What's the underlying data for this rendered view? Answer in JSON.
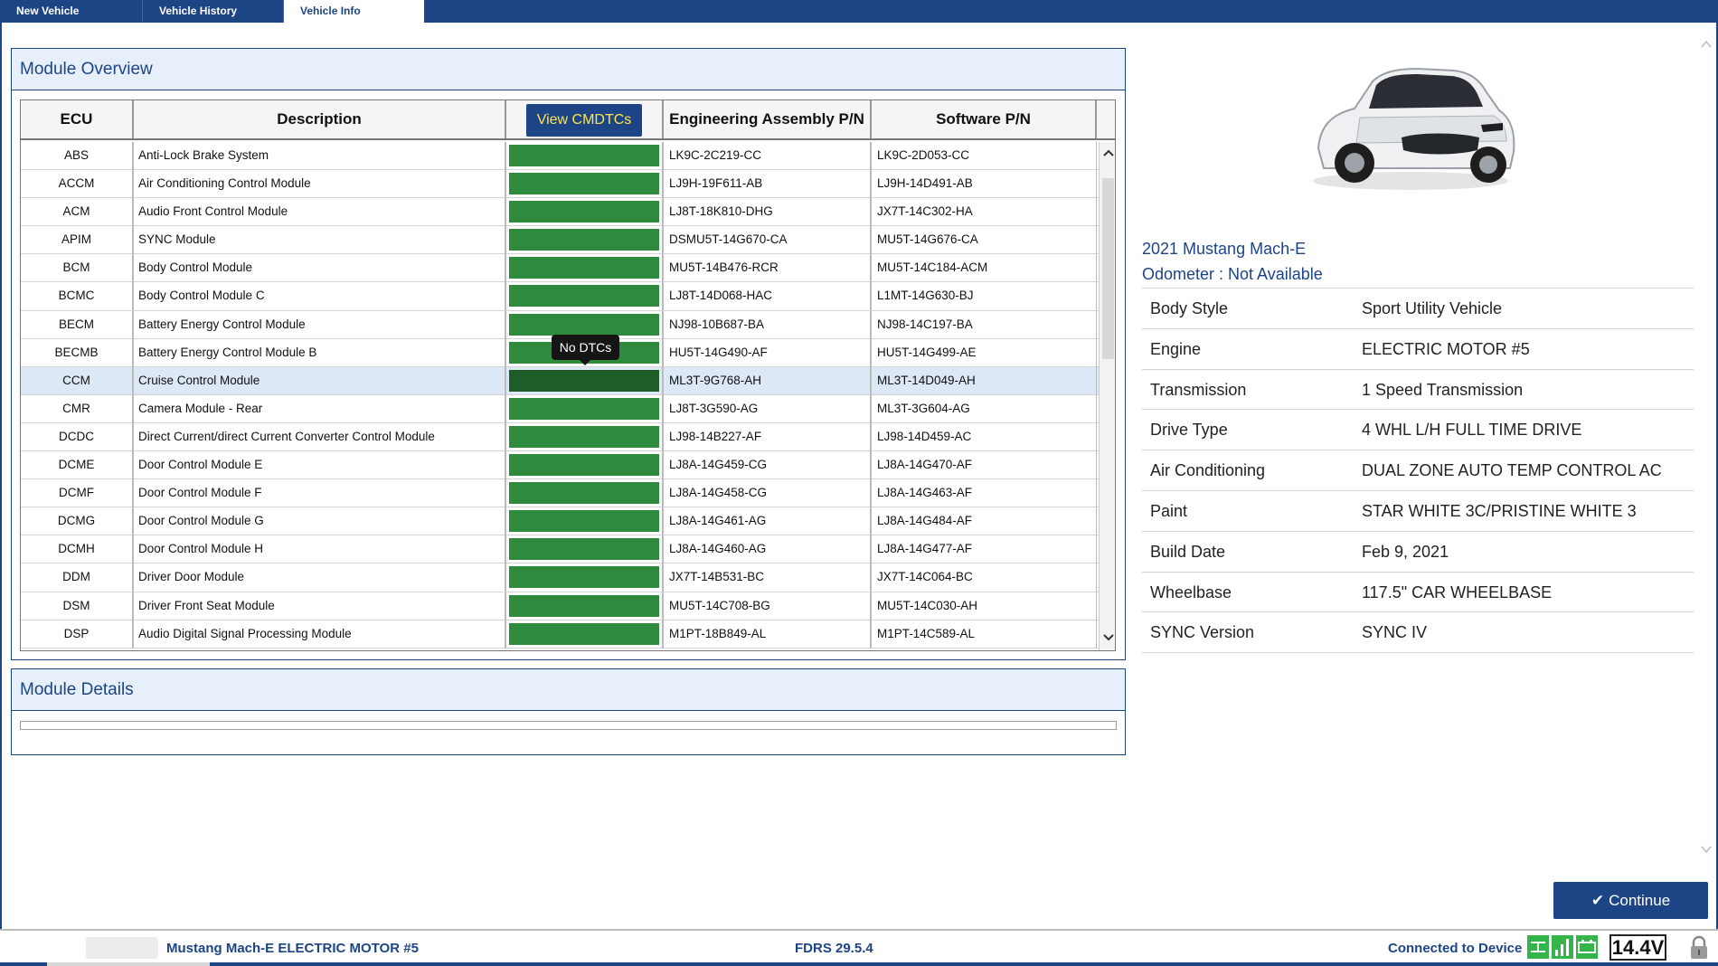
{
  "tabs": [
    {
      "label": "New Vehicle"
    },
    {
      "label": "Vehicle History"
    },
    {
      "label": "Vehicle Info"
    }
  ],
  "overview": {
    "title": "Module Overview",
    "columns": {
      "ecu": "ECU",
      "description": "Description",
      "dtc_button": "View CMDTCs",
      "eng": "Engineering Assembly P/N",
      "sw": "Software P/N"
    },
    "rows": [
      {
        "ecu": "ABS",
        "desc": "Anti-Lock Brake System",
        "eng": "LK9C-2C219-CC",
        "sw": "LK9C-2D053-CC"
      },
      {
        "ecu": "ACCM",
        "desc": "Air Conditioning Control Module",
        "eng": "LJ9H-19F611-AB",
        "sw": "LJ9H-14D491-AB"
      },
      {
        "ecu": "ACM",
        "desc": "Audio Front Control Module",
        "eng": "LJ8T-18K810-DHG",
        "sw": "JX7T-14C302-HA"
      },
      {
        "ecu": "APIM",
        "desc": "SYNC Module",
        "eng": "DSMU5T-14G670-CA",
        "sw": "MU5T-14G676-CA"
      },
      {
        "ecu": "BCM",
        "desc": "Body Control Module",
        "eng": "MU5T-14B476-RCR",
        "sw": "MU5T-14C184-ACM"
      },
      {
        "ecu": "BCMC",
        "desc": "Body Control Module C",
        "eng": "LJ8T-14D068-HAC",
        "sw": "L1MT-14G630-BJ"
      },
      {
        "ecu": "BECM",
        "desc": "Battery Energy Control Module",
        "eng": "NJ98-10B687-BA",
        "sw": "NJ98-14C197-BA"
      },
      {
        "ecu": "BECMB",
        "desc": "Battery Energy Control Module B",
        "eng": "HU5T-14G490-AF",
        "sw": "HU5T-14G499-AE"
      },
      {
        "ecu": "CCM",
        "desc": "Cruise Control Module",
        "eng": "ML3T-9G768-AH",
        "sw": "ML3T-14D049-AH"
      },
      {
        "ecu": "CMR",
        "desc": "Camera Module - Rear",
        "eng": "LJ8T-3G590-AG",
        "sw": "ML3T-3G604-AG"
      },
      {
        "ecu": "DCDC",
        "desc": "Direct Current/direct Current Converter Control Module",
        "eng": "LJ98-14B227-AF",
        "sw": "LJ98-14D459-AC"
      },
      {
        "ecu": "DCME",
        "desc": "Door Control Module E",
        "eng": "LJ8A-14G459-CG",
        "sw": "LJ8A-14G470-AF"
      },
      {
        "ecu": "DCMF",
        "desc": "Door Control Module F",
        "eng": "LJ8A-14G458-CG",
        "sw": "LJ8A-14G463-AF"
      },
      {
        "ecu": "DCMG",
        "desc": "Door Control Module G",
        "eng": "LJ8A-14G461-AG",
        "sw": "LJ8A-14G484-AF"
      },
      {
        "ecu": "DCMH",
        "desc": "Door Control Module H",
        "eng": "LJ8A-14G460-AG",
        "sw": "LJ8A-14G477-AF"
      },
      {
        "ecu": "DDM",
        "desc": "Driver Door Module",
        "eng": "JX7T-14B531-BC",
        "sw": "JX7T-14C064-BC"
      },
      {
        "ecu": "DSM",
        "desc": "Driver Front Seat Module",
        "eng": "MU5T-14C708-BG",
        "sw": "MU5T-14C030-AH"
      },
      {
        "ecu": "DSP",
        "desc": "Audio Digital Signal Processing Module",
        "eng": "M1PT-18B849-AL",
        "sw": "M1PT-14C589-AL"
      }
    ],
    "selected_row": "CCM",
    "tooltip": "No DTCs"
  },
  "details": {
    "title": "Module Details"
  },
  "vehicle": {
    "title": "2021 Mustang Mach-E",
    "odometer": "Odometer : Not Available",
    "specs": [
      {
        "k": "Body Style",
        "v": "Sport Utility Vehicle"
      },
      {
        "k": "Engine",
        "v": "ELECTRIC MOTOR #5"
      },
      {
        "k": "Transmission",
        "v": "1 Speed Transmission"
      },
      {
        "k": "Drive Type",
        "v": "4 WHL L/H FULL TIME DRIVE"
      },
      {
        "k": "Air Conditioning",
        "v": "DUAL ZONE AUTO TEMP CONTROL AC"
      },
      {
        "k": "Paint",
        "v": "STAR WHITE 3C/PRISTINE WHITE 3"
      },
      {
        "k": "Build Date",
        "v": "Feb 9, 2021"
      },
      {
        "k": "Wheelbase",
        "v": "117.5\" CAR WHEELBASE"
      },
      {
        "k": "SYNC Version",
        "v": "SYNC IV"
      }
    ]
  },
  "continue_label": "Continue",
  "status": {
    "vehicle": "Mustang Mach-E ELECTRIC MOTOR #5",
    "version": "FDRS 29.5.4",
    "connection": "Connected to Device",
    "voltage": "14.4V"
  },
  "colors": {
    "brand_blue": "#1d4585",
    "dtc_ok": "#2e8b3d",
    "dtc_ok_selected": "#1e5c28",
    "button_text": "#ffe34d",
    "status_icon": "#33b549"
  },
  "icons": [
    "chevron-up-icon",
    "chevron-down-icon",
    "check-icon",
    "network-icon",
    "signal-icon",
    "battery-icon",
    "lock-icon"
  ]
}
